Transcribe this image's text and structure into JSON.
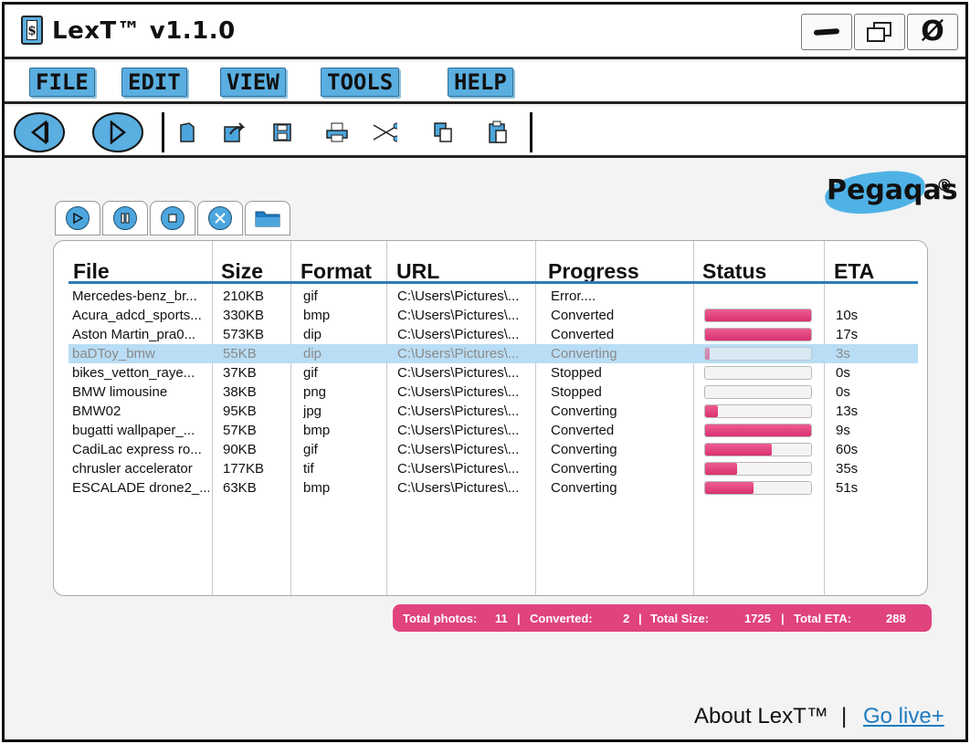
{
  "app": {
    "title": "LexT™ v1.1.0",
    "icon_glyph": "$"
  },
  "window_controls": {
    "minimize_icon": "minimize-icon",
    "maximize_icon": "restore-icon",
    "close_glyph": "Ø"
  },
  "menu": [
    {
      "label": "FILE"
    },
    {
      "label": "EDIT"
    },
    {
      "label": "VIEW"
    },
    {
      "label": "TOOLS"
    },
    {
      "label": "HELP"
    }
  ],
  "toolbar": {
    "back_icon": "back-icon",
    "forward_icon": "forward-icon",
    "tools": [
      "new-file-icon",
      "share-icon",
      "save-icon",
      "print-icon",
      "cut-icon",
      "copy-icon",
      "paste-icon"
    ]
  },
  "logo": {
    "text": "Pegaqas",
    "reg": "®"
  },
  "media_controls": [
    "play-icon",
    "pause-icon",
    "stop-icon",
    "tools-icon",
    "folder-icon"
  ],
  "table": {
    "headers": [
      "File",
      "Size",
      "Format",
      "URL",
      "Progress",
      "Status",
      "ETA"
    ],
    "rows": [
      {
        "file": "Mercedes-benz_br...",
        "size": "210KB",
        "format": "gif",
        "url": "C:\\Users\\Pictures\\...",
        "progress": "Error....",
        "status": null,
        "eta": ""
      },
      {
        "file": "Acura_adcd_sports...",
        "size": "330KB",
        "format": "bmp",
        "url": "C:\\Users\\Pictures\\...",
        "progress": "Converted",
        "status": 100,
        "eta": "10s"
      },
      {
        "file": "Aston Martin_pra0...",
        "size": "573KB",
        "format": "dip",
        "url": "C:\\Users\\Pictures\\...",
        "progress": "Converted",
        "status": 100,
        "eta": "17s"
      },
      {
        "file": "baDToy_bmw",
        "size": "55KB",
        "format": "dip",
        "url": "C:\\Users\\Pictures\\...",
        "progress": "Converting",
        "status": 4,
        "eta": "3s",
        "selected": true
      },
      {
        "file": "bikes_vetton_raye...",
        "size": "37KB",
        "format": "gif",
        "url": "C:\\Users\\Pictures\\...",
        "progress": "Stopped",
        "status": 0,
        "eta": "0s"
      },
      {
        "file": "BMW limousine",
        "size": "38KB",
        "format": "png",
        "url": "C:\\Users\\Pictures\\...",
        "progress": "Stopped",
        "status": 0,
        "eta": "0s"
      },
      {
        "file": "BMW02",
        "size": "95KB",
        "format": "jpg",
        "url": "C:\\Users\\Pictures\\...",
        "progress": "Converting",
        "status": 12,
        "eta": "13s"
      },
      {
        "file": "bugatti wallpaper_...",
        "size": "57KB",
        "format": "bmp",
        "url": "C:\\Users\\Pictures\\...",
        "progress": "Converted",
        "status": 100,
        "eta": "9s"
      },
      {
        "file": "CadiLac express ro...",
        "size": "90KB",
        "format": "gif",
        "url": "C:\\Users\\Pictures\\...",
        "progress": "Converting",
        "status": 63,
        "eta": "60s"
      },
      {
        "file": "chrusler accelerator",
        "size": "177KB",
        "format": "tif",
        "url": "C:\\Users\\Pictures\\...",
        "progress": "Converting",
        "status": 30,
        "eta": "35s"
      },
      {
        "file": "ESCALADE drone2_...",
        "size": "63KB",
        "format": "bmp",
        "url": "C:\\Users\\Pictures\\...",
        "progress": "Converting",
        "status": 46,
        "eta": "51s"
      }
    ]
  },
  "summary": {
    "total_photos_label": "Total photos:",
    "total_photos": "11",
    "converted_label": "Converted:",
    "converted": "2",
    "total_size_label": "Total Size:",
    "total_size": "1725",
    "total_eta_label": "Total ETA:",
    "total_eta": "288",
    "divider": "|"
  },
  "footer": {
    "about": "About LexT™",
    "divider": "|",
    "go_live": "Go live+"
  },
  "colors": {
    "accent_blue": "#5aaee0",
    "progress_pink": "#e0437e",
    "header_rule": "#2b7bb5"
  }
}
